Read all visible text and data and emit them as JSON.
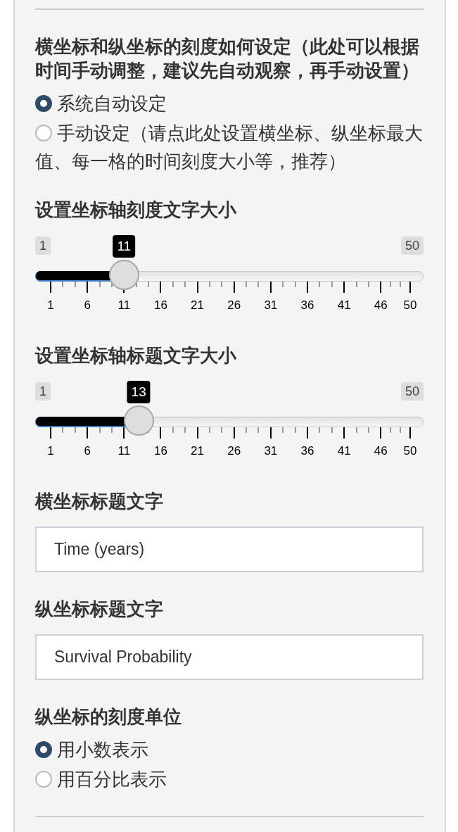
{
  "sections": [
    {
      "kind": "radio_group",
      "label": "横坐标和纵坐标的刻度如何设定（此处可以根据时间手动调整，建议先自动观察，再手动设置）",
      "options": [
        {
          "label": "系统自动设定",
          "selected": true
        },
        {
          "label": "手动设定（请点此处设置横坐标、纵坐标最大值、每一格的时间刻度大小等，推荐）",
          "selected": false
        }
      ]
    },
    {
      "kind": "slider",
      "label": "设置坐标轴刻度文字大小",
      "min": "1",
      "max": "50",
      "value": "11",
      "level": 0.2041,
      "ticks": [
        "1",
        "6",
        "11",
        "16",
        "21",
        "26",
        "31",
        "36",
        "41",
        "46",
        "50"
      ]
    },
    {
      "kind": "slider",
      "label": "设置坐标轴标题文字大小",
      "min": "1",
      "max": "50",
      "value": "13",
      "level": 0.2449,
      "ticks": [
        "1",
        "6",
        "11",
        "16",
        "21",
        "26",
        "31",
        "36",
        "41",
        "46",
        "50"
      ]
    },
    {
      "kind": "text_input",
      "label": "横坐标标题文字",
      "value": "Time (years)"
    },
    {
      "kind": "text_input",
      "label": "纵坐标标题文字",
      "value": "Survival Probability"
    },
    {
      "kind": "radio_group",
      "label": "纵坐标的刻度单位",
      "options": [
        {
          "label": "用小数表示",
          "selected": true
        },
        {
          "label": "用百分比表示",
          "selected": false
        }
      ]
    }
  ]
}
